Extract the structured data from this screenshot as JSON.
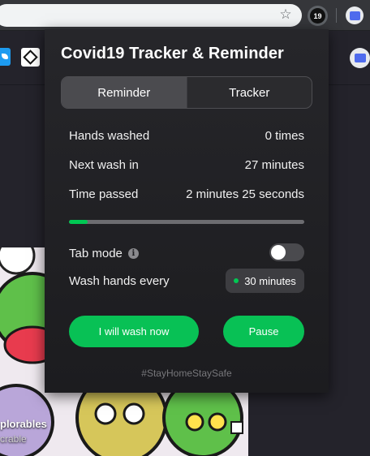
{
  "browser": {
    "extension_badge": "19"
  },
  "background_page": {
    "artwork_title": "plorables",
    "artwork_subtitle": "crable"
  },
  "popup": {
    "title": "Covid19 Tracker & Reminder",
    "tabs": [
      {
        "label": "Reminder",
        "active": true
      },
      {
        "label": "Tracker",
        "active": false
      }
    ],
    "stats": {
      "hands_washed_label": "Hands washed",
      "hands_washed_value": "0 times",
      "next_wash_label": "Next wash in",
      "next_wash_value": "27 minutes",
      "time_passed_label": "Time passed",
      "time_passed_value": "2 minutes 25 seconds"
    },
    "progress_fraction": 0.08,
    "tab_mode_label": "Tab mode",
    "tab_mode_enabled": false,
    "wash_every_label": "Wash hands every",
    "wash_every_value": "30 minutes",
    "primary_button": "I will wash now",
    "secondary_button": "Pause",
    "hashtag": "#StayHomeStaySafe"
  },
  "colors": {
    "accent_green": "#08c155",
    "popup_bg": "#1f1f22"
  }
}
